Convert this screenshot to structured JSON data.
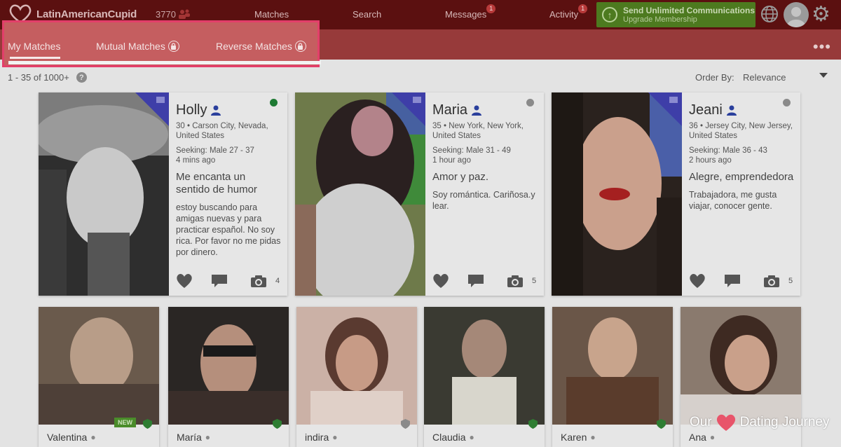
{
  "header": {
    "logo_text": "LatinAmericanCupid",
    "count": "3770",
    "nav": [
      {
        "label": "Matches",
        "badge": ""
      },
      {
        "label": "Search",
        "badge": ""
      },
      {
        "label": "Messages",
        "badge": "1"
      },
      {
        "label": "Activity",
        "badge": "1"
      }
    ],
    "upgrade": {
      "line1": "Send Unlimited Communications",
      "line2": "Upgrade Membership"
    }
  },
  "tabs": [
    {
      "label": "My Matches",
      "active": true,
      "locked": false
    },
    {
      "label": "Mutual Matches",
      "active": false,
      "locked": true
    },
    {
      "label": "Reverse Matches",
      "active": false,
      "locked": true
    }
  ],
  "toolbar": {
    "results": "1 - 35 of 1000+",
    "help": "?",
    "order_by_label": "Order By:",
    "order_by_value": "Relevance",
    "more": "•••"
  },
  "cards": [
    {
      "name": "Holly",
      "location": "30 • Carson City, Nevada, United States",
      "seeking": "Seeking: Male 27 - 37",
      "time": "4 mins ago",
      "headline": "Me encanta un sentido de humor",
      "description": "estoy buscando para amigas nuevas y para practicar español. No soy rica. Por favor no me pidas por dinero.",
      "photos": "4",
      "online_color": "#1e7a33"
    },
    {
      "name": "Maria",
      "location": "35 • New York, New York, United States",
      "seeking": "Seeking: Male 31 - 49",
      "time": "1 hour ago",
      "headline": "Amor y paz.",
      "description": "Soy romántica. Cariñosa.y lear.",
      "photos": "5",
      "online_color": "#8a8a8a"
    },
    {
      "name": "Jeani",
      "location": "36 • Jersey City, New Jersey, United States",
      "seeking": "Seeking: Male 36 - 43",
      "time": "2 hours ago",
      "headline": "Alegre, emprendedora",
      "description": "Trabajadora, me gusta viajar, conocer gente.",
      "photos": "5",
      "online_color": "#8a8a8a"
    }
  ],
  "tiles": [
    {
      "name": "Valentina",
      "badge": "NEW"
    },
    {
      "name": "María",
      "badge": ""
    },
    {
      "name": "indira",
      "badge": ""
    },
    {
      "name": "Claudia",
      "badge": ""
    },
    {
      "name": "Karen",
      "badge": ""
    },
    {
      "name": "Ana",
      "badge": ""
    }
  ],
  "watermark": {
    "before": "Our",
    "after": "Dating Journey"
  },
  "colors": {
    "topbar": "#5b1010",
    "subbar": "#973a3a",
    "highlight_border": "#e33f6a",
    "online": "#1e7a33",
    "upgrade": "#4d7a1f"
  }
}
